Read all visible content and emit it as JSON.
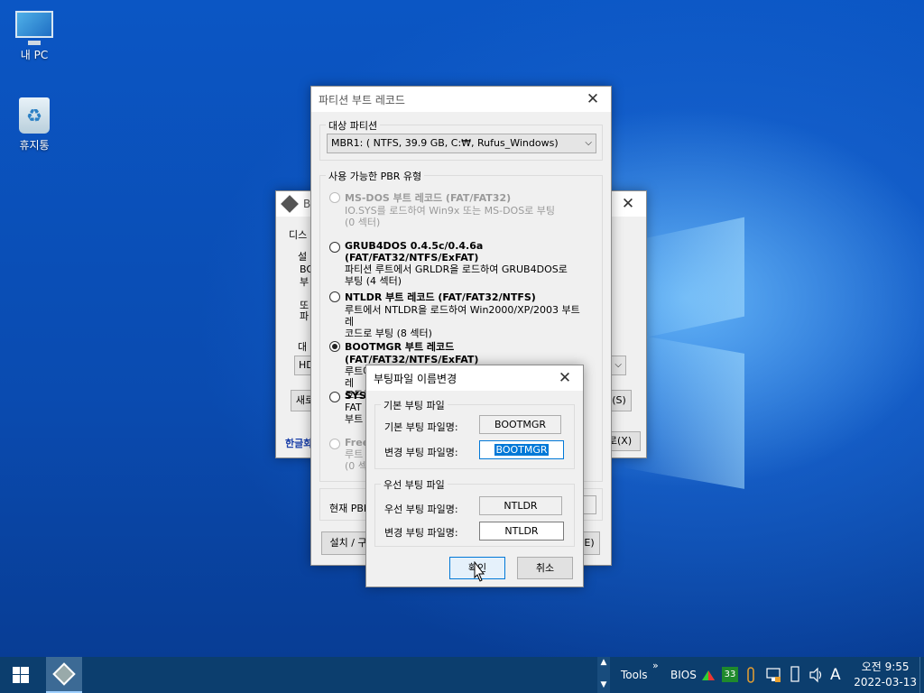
{
  "desktop": {
    "icons": [
      {
        "label": "내 PC",
        "icon": "computer-icon"
      },
      {
        "label": "휴지통",
        "icon": "recycle-bin-icon"
      }
    ]
  },
  "bg_window": {
    "title_fragment": "B(",
    "tab_fragment": "디스",
    "group_fragment": "설",
    "text_lines": [
      "BO",
      "부",
      "또",
      "파"
    ],
    "label_fragment": "대",
    "combo_fragment": "HD",
    "new_button_fragment": "새로",
    "right_button_fragment": "(S)",
    "link_fragment": "한글화",
    "exit_button_fragment": "로(X)"
  },
  "pbr_window": {
    "title": "파티션 부트 레코드",
    "target_group_label": "대상 파티션",
    "target_value": "MBR1: ( NTFS,  39.9 GB, C:₩, Rufus_Windows)",
    "available_group_label": "사용 가능한 PBR 유형",
    "options": [
      {
        "title": "MS-DOS 부트 레코드 (FAT/FAT32)",
        "desc": [
          "IO.SYS를 로드하여 Win9x 또는 MS-DOS로 부팅",
          " (0 섹터)"
        ]
      },
      {
        "title": "GRUB4DOS 0.4.5c/0.4.6a (FAT/FAT32/NTFS/ExFAT)",
        "desc": [
          "파티션 루트에서 GRLDR을 로드하여 GRUB4DOS로",
          "부팅 (4 섹터)"
        ]
      },
      {
        "title": "NTLDR 부트 레코드 (FAT/FAT32/NTFS)",
        "desc": [
          "루트에서 NTLDR을 로드하여 Win2000/XP/2003 부트 레",
          "코드로 부팅 (8 섹터)"
        ]
      },
      {
        "title": "BOOTMGR 부트 레코드 (FAT/FAT32/NTFS/ExFAT)",
        "desc": [
          "루트에서 BOOTMGR을 로드하여 Win Vista/7/8 부트 레",
          "코드로"
        ]
      },
      {
        "title": "SYS",
        "desc": [
          "FAT",
          "부트"
        ]
      },
      {
        "title": "Free",
        "desc": [
          "루트",
          "(0 섹"
        ]
      }
    ],
    "current_pbr_label": "현재 PBR",
    "install_button": "설치 / 구",
    "right_button_fragment": "E)"
  },
  "rename_dialog": {
    "title": "부팅파일 이름변경",
    "default_group": "기본 부팅 파일",
    "default_file_label": "기본 부팅 파일명:",
    "default_file_value": "BOOTMGR",
    "change_file_label": "변경 부팅 파일명:",
    "change_file_value": "BOOTMGR",
    "priority_group": "우선 부팅 파일",
    "priority_file_label": "우선 부팅 파일명:",
    "priority_file_value": "NTLDR",
    "change_priority_label": "변경 부팅 파일명:",
    "change_priority_value": "NTLDR",
    "ok_button": "확인",
    "cancel_button": "취소"
  },
  "taskbar": {
    "tools_label": "Tools",
    "bios_label": "BIOS",
    "badge_number": "33",
    "ime_label": "A",
    "time": "오전 9:55",
    "date": "2022-03-13"
  }
}
